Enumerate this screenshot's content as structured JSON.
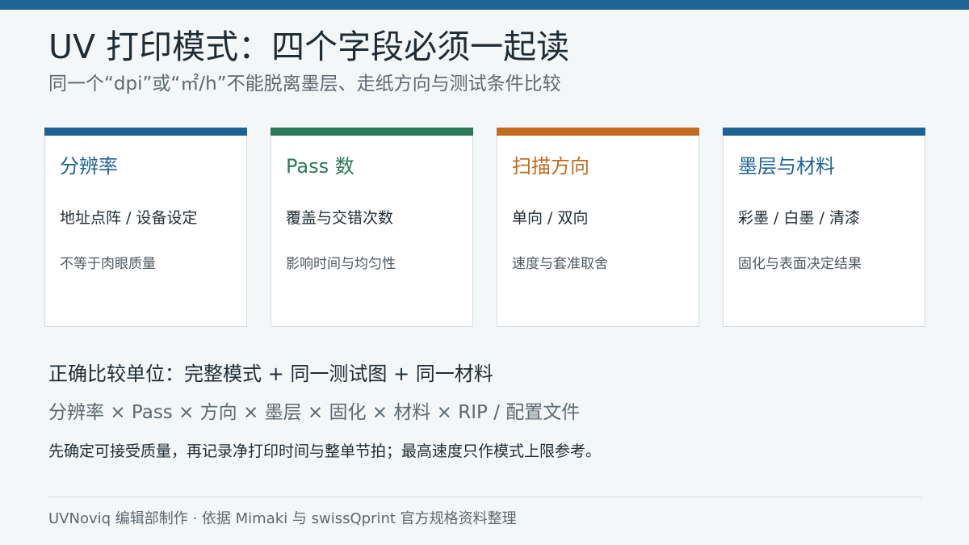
{
  "title": "UV 打印模式：四个字段必须一起读",
  "subtitle": "同一个“dpi”或“㎡/h”不能脱离墨层、走纸方向与测试条件比较",
  "colors": {
    "top_bar": "#1d6494",
    "blue": "#1d6494",
    "green": "#2b7a57",
    "orange": "#c26a1f"
  },
  "cards": [
    {
      "title": "分辨率",
      "item": "地址点阵 / 设备设定",
      "note": "不等于肉眼质量",
      "accent": "#1d6494"
    },
    {
      "title": "Pass 数",
      "item": "覆盖与交错次数",
      "note": "影响时间与均匀性",
      "accent": "#2b7a57"
    },
    {
      "title": "扫描方向",
      "item": "单向 / 双向",
      "note": "速度与套准取舍",
      "accent": "#c26a1f"
    },
    {
      "title": "墨层与材料",
      "item": "彩墨 / 白墨 / 清漆",
      "note": "固化与表面决定结果",
      "accent": "#1d6494"
    }
  ],
  "summary": {
    "heading": "正确比较单位：完整模式 + 同一测试图 + 同一材料",
    "formula": "分辨率 × Pass × 方向 × 墨层 × 固化 × 材料 × RIP / 配置文件",
    "advice": "先确定可接受质量，再记录净打印时间与整单节拍；最高速度只作模式上限参考。"
  },
  "footer": "UVNoviq 编辑部制作 · 依据 Mimaki 与 swissQprint 官方规格资料整理"
}
